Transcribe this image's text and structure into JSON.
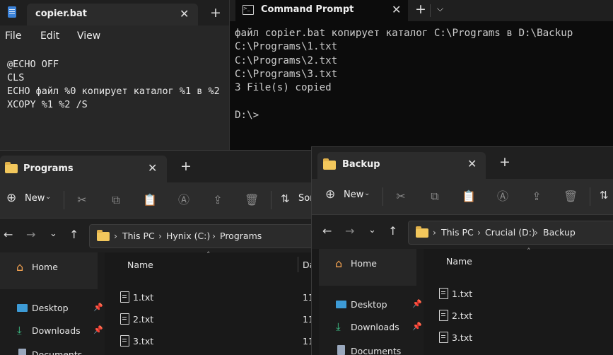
{
  "notepad": {
    "tab_title": "copier.bat",
    "menu": [
      "File",
      "Edit",
      "View"
    ],
    "lines": [
      "@ECHO OFF",
      "CLS",
      "ECHO файл %0 копирует каталог %1 в %2",
      "XCOPY %1 %2 /S"
    ]
  },
  "cmd": {
    "tab_title": "Command Prompt",
    "lines": [
      "файл copier.bat копирует каталог C:\\Programs в D:\\Backup",
      "C:\\Programs\\1.txt",
      "C:\\Programs\\2.txt",
      "C:\\Programs\\3.txt",
      "3 File(s) copied",
      "",
      "D:\\>"
    ]
  },
  "explorer_left": {
    "tab_title": "Programs",
    "new_label": "New",
    "sort_label": "Sor",
    "breadcrumb": [
      "This PC",
      "Hynix (C:)",
      "Programs"
    ],
    "sidebar": {
      "home": "Home",
      "desktop": "Desktop",
      "downloads": "Downloads",
      "documents": "Documents"
    },
    "col_name": "Name",
    "col_date": "Da",
    "files": [
      "1.txt",
      "2.txt",
      "3.txt"
    ],
    "dates": [
      "11",
      "11",
      "11"
    ]
  },
  "explorer_right": {
    "tab_title": "Backup",
    "new_label": "New",
    "breadcrumb": [
      "This PC",
      "Crucial (D:)",
      "Backup"
    ],
    "sidebar": {
      "home": "Home",
      "desktop": "Desktop",
      "downloads": "Downloads",
      "documents": "Documents"
    },
    "col_name": "Name",
    "files": [
      "1.txt",
      "2.txt",
      "3.txt"
    ]
  }
}
